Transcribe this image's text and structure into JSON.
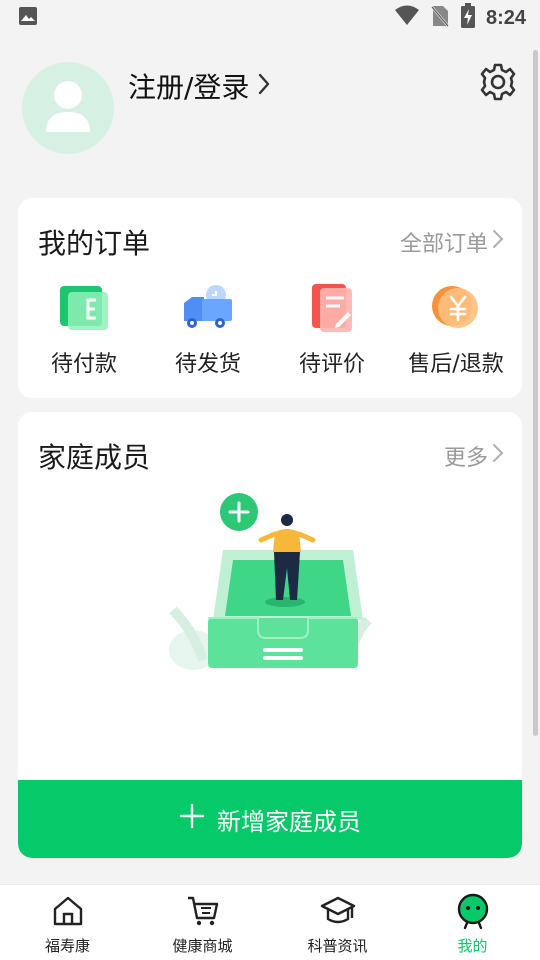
{
  "status_bar": {
    "time": "8:24"
  },
  "profile": {
    "login_label": "注册/登录"
  },
  "orders": {
    "title": "我的订单",
    "all_label": "全部订单",
    "items": [
      {
        "label": "待付款",
        "icon": "wallet-icon"
      },
      {
        "label": "待发货",
        "icon": "truck-icon"
      },
      {
        "label": "待评价",
        "icon": "review-icon"
      },
      {
        "label": "售后/退款",
        "icon": "refund-icon"
      }
    ]
  },
  "family": {
    "title": "家庭成员",
    "more_label": "更多",
    "add_button": "新增家庭成员"
  },
  "tabbar": {
    "items": [
      {
        "label": "福寿康",
        "icon": "home-icon"
      },
      {
        "label": "健康商城",
        "icon": "cart-icon"
      },
      {
        "label": "科普资讯",
        "icon": "graduation-cap-icon"
      },
      {
        "label": "我的",
        "icon": "profile-face-icon"
      }
    ],
    "active_index": 3
  },
  "colors": {
    "accent": "#06c96a",
    "background": "#f3f3f3"
  }
}
